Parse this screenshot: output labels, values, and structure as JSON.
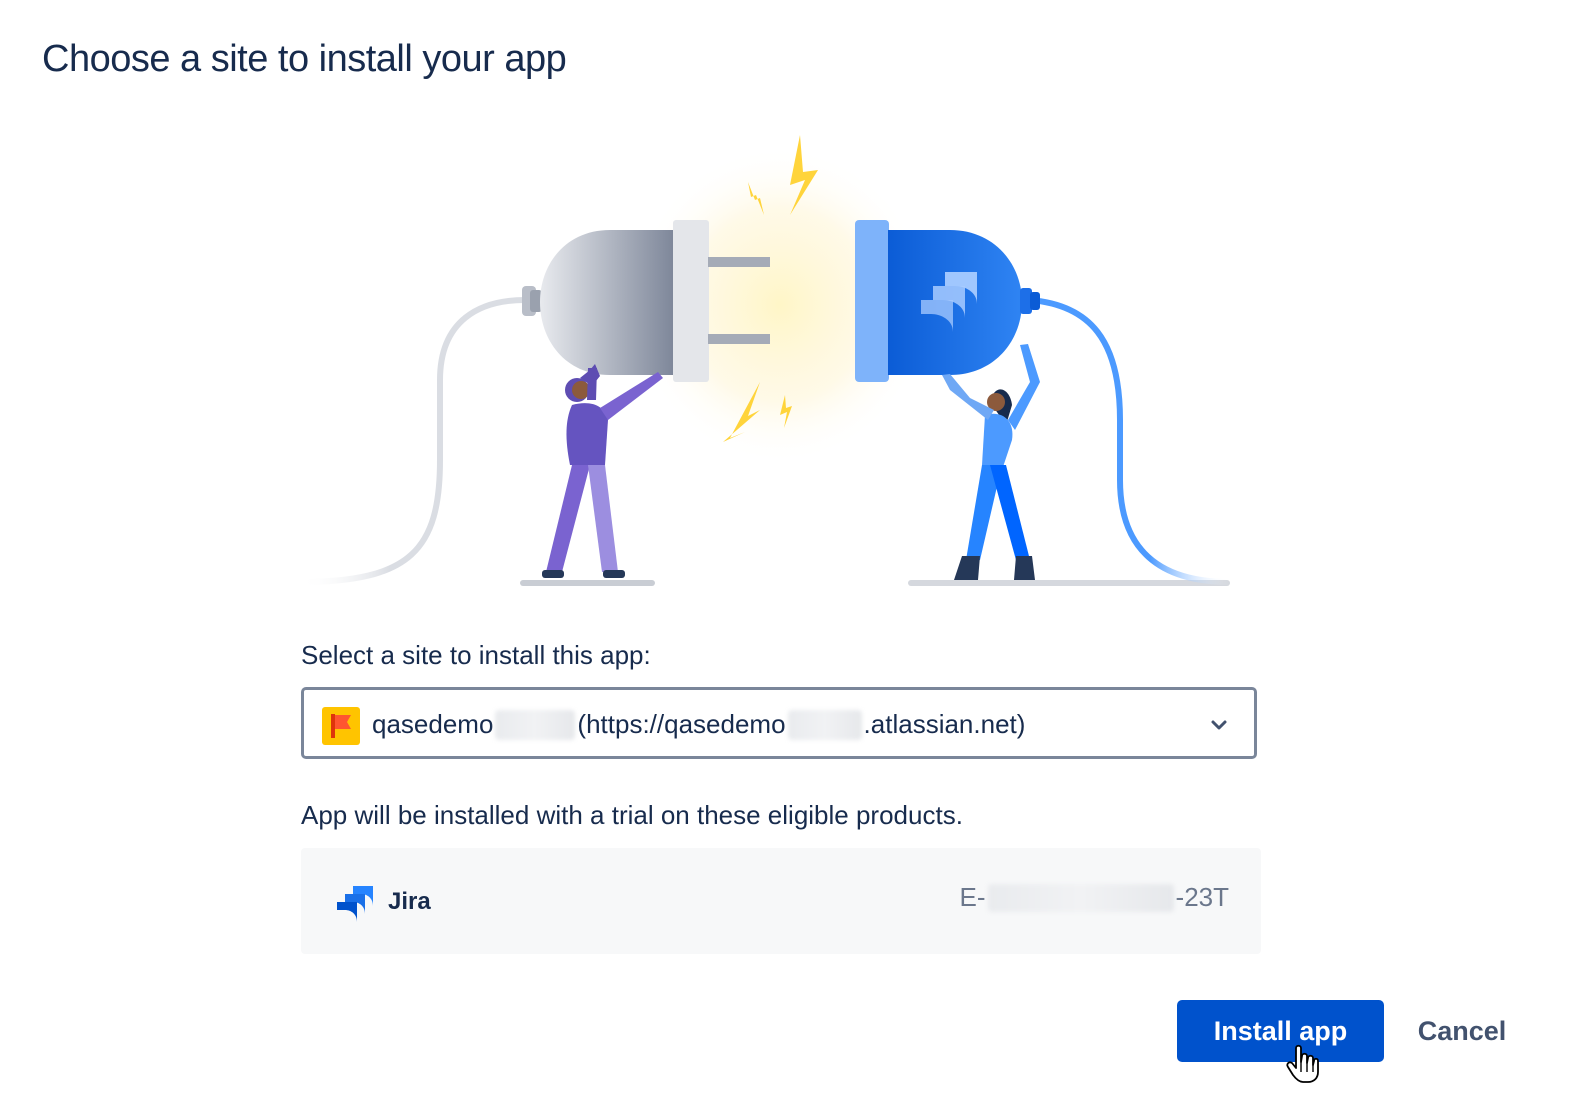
{
  "title": "Choose a site to install your app",
  "site_select": {
    "label": "Select a site to install this app:",
    "value_prefix": "qasedemo",
    "value_middle": "(https://qasedemo",
    "value_suffix": ".atlassian.net)",
    "icon": "site-flag-icon"
  },
  "products": {
    "label": "App will be installed with a trial on these eligible products.",
    "items": [
      {
        "name": "Jira",
        "icon": "jira-icon",
        "license_prefix": "E-",
        "license_suffix": "-23T"
      }
    ]
  },
  "actions": {
    "install_label": "Install app",
    "cancel_label": "Cancel"
  },
  "colors": {
    "primary": "#0052CC",
    "text": "#172B4D",
    "subtle_text": "#6B778C",
    "select_border": "#7A869A",
    "product_bg": "#F7F8F9"
  }
}
